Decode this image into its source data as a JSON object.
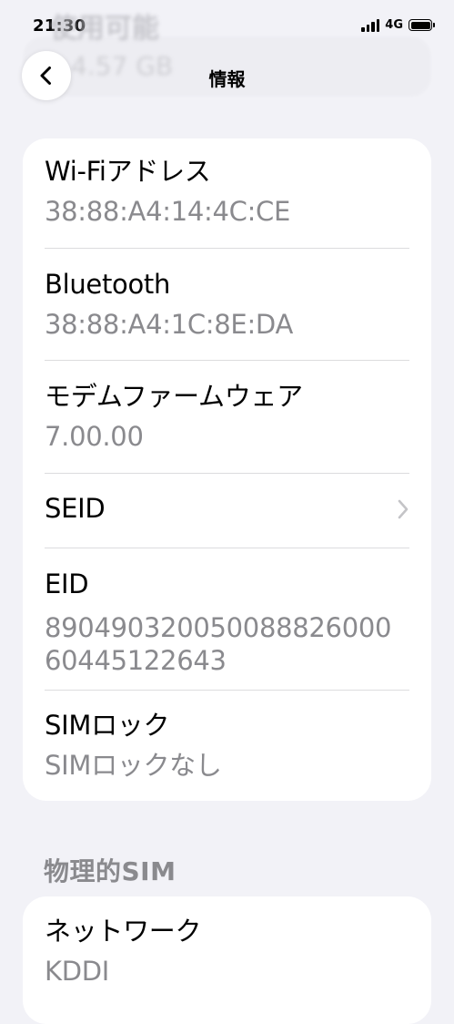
{
  "status_bar": {
    "time": "21:30",
    "network": "4G",
    "battery_level": 1.0
  },
  "background": {
    "ghost_title": "使用可能",
    "ghost_value": "4.57 GB"
  },
  "nav": {
    "back_icon": "chevron-left-icon",
    "title": "情報"
  },
  "info_rows": [
    {
      "label": "Wi-Fiアドレス",
      "value": "38:88:A4:14:4C:CE"
    },
    {
      "label": "Bluetooth",
      "value": "38:88:A4:1C:8E:DA"
    },
    {
      "label": "モデムファームウェア",
      "value": "7.00.00"
    },
    {
      "label": "SEID",
      "icon": "chevron-right-icon"
    },
    {
      "label": "EID",
      "value_line1": "890490320050088826000",
      "value_line2": "60445122643"
    },
    {
      "label": "SIMロック",
      "value": "SIMロックなし"
    }
  ],
  "physical_sim": {
    "header": "物理的SIM",
    "rows": [
      {
        "label": "ネットワーク",
        "value": "KDDI"
      }
    ]
  },
  "colors": {
    "background": "#f2f2f7",
    "card": "#ffffff",
    "secondary_text": "#8a8a8e",
    "separator": "#dcdcde"
  }
}
